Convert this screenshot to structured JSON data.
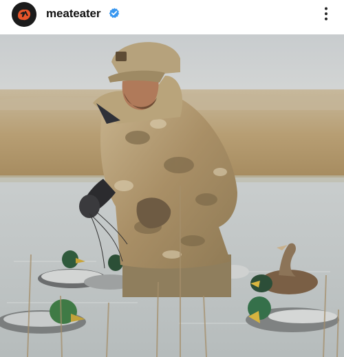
{
  "post": {
    "username": "meateater",
    "verified": true,
    "icons": {
      "avatar": "meateater-logo-icon",
      "verified": "verified-badge-icon",
      "more": "more-options-icon"
    },
    "colors": {
      "avatar_bg": "#1b1b1b",
      "avatar_logo": "#e8552a",
      "verified": "#3897f0"
    }
  },
  "photo": {
    "subject": "duck-hunter-in-camouflage-wading-among-decoys",
    "icon": "post-photo"
  }
}
